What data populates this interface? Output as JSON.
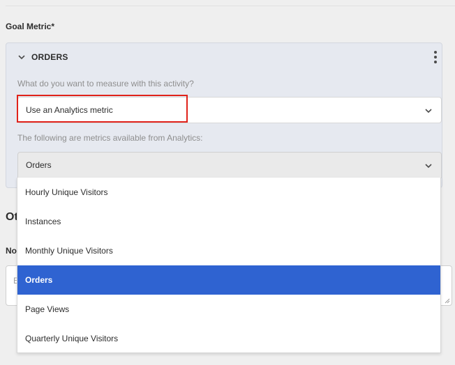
{
  "form": {
    "goal_metric_label": "Goal Metric*"
  },
  "card": {
    "title": "ORDERS",
    "question": "What do you want to measure with this activity?",
    "source_select_value": "Use an Analytics metric",
    "metrics_hint": "The following are metrics available from Analytics:",
    "metric_select_value": "Orders"
  },
  "dropdown": {
    "options": [
      {
        "label": "Hourly Unique Visitors",
        "selected": false
      },
      {
        "label": "Instances",
        "selected": false
      },
      {
        "label": "Monthly Unique Visitors",
        "selected": false
      },
      {
        "label": "Orders",
        "selected": true
      },
      {
        "label": "Page Views",
        "selected": false
      },
      {
        "label": "Quarterly Unique Visitors",
        "selected": false
      }
    ]
  },
  "background": {
    "heading_fragment": "Ot",
    "label_fragment": "No",
    "textarea_fragment": "E"
  },
  "colors": {
    "page_bg": "#efefef",
    "card_bg": "#e6e9f0",
    "selected_option": "#2f63d1",
    "highlight_border": "#e0221a"
  },
  "icons": {
    "collapse": "chevron-down-icon",
    "menu": "more-vertical-icon",
    "select": "chevron-down-icon"
  }
}
